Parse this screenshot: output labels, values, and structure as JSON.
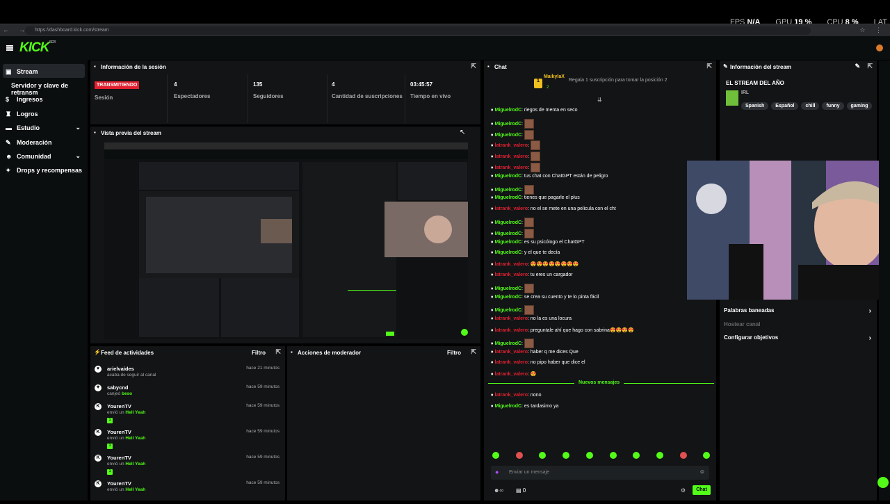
{
  "system_stats": {
    "fps_label": "FPS",
    "fps": "N/A",
    "gpu_label": "GPU",
    "gpu": "19 %",
    "cpu_label": "CPU",
    "cpu": "8 %",
    "lat_label": "LAT"
  },
  "browser": {
    "url": "https://dashboard.kick.com/stream"
  },
  "app": {
    "logo": "KICK",
    "logo_badge": "BETA"
  },
  "sidebar": {
    "items": [
      {
        "label": "Stream",
        "icon": "stream-icon"
      },
      {
        "label": "Servidor y clave de retransm"
      },
      {
        "label": "Ingresos",
        "icon": "money-icon"
      },
      {
        "label": "Logros",
        "icon": "trophy-icon"
      },
      {
        "label": "Estudio",
        "icon": "studio-icon"
      },
      {
        "label": "Moderación",
        "icon": "mod-icon"
      },
      {
        "label": "Comunidad",
        "icon": "community-icon"
      },
      {
        "label": "Drops y recompensas",
        "icon": "gift-icon"
      }
    ]
  },
  "session": {
    "title": "Información de la sesión",
    "live_badge": "TRANSMITIENDO",
    "session_label": "Sesión",
    "viewers": "4",
    "viewers_label": "Espectadores",
    "followers": "135",
    "followers_label": "Seguidores",
    "subs": "4",
    "subs_label": "Cantidad de suscripciones",
    "time": "03:45:57",
    "time_label": "Tiempo en vivo"
  },
  "preview": {
    "title": "Vista previa del stream"
  },
  "feed": {
    "title": "Feed de actividades",
    "filter": "Filtro",
    "items": [
      {
        "name": "arielvaides",
        "sub": "acaba de seguir al canal",
        "highlight": "",
        "time": "hace 21 minutos"
      },
      {
        "name": "sabycnd",
        "sub": "canjeó",
        "highlight": "beso",
        "time": "hace 59 minutos"
      },
      {
        "name": "YourenTV",
        "sub": "envió un",
        "highlight": "Hell Yeah",
        "time": "hace 59 minutos",
        "count": "1"
      },
      {
        "name": "YourenTV",
        "sub": "envió un",
        "highlight": "Hell Yeah",
        "time": "hace 59 minutos",
        "count": "1"
      },
      {
        "name": "YourenTV",
        "sub": "envió un",
        "highlight": "Hell Yeah",
        "time": "hace 59 minutos",
        "count": "1"
      },
      {
        "name": "YourenTV",
        "sub": "envió un",
        "highlight": "Hell Yeah",
        "time": "hace 59 minutos",
        "count": ""
      }
    ]
  },
  "mod": {
    "title": "Acciones de moderador",
    "filter": "Filtro"
  },
  "chat": {
    "title": "Chat",
    "top_user": "MaikylaX",
    "top_rank": "1",
    "top_count": "2",
    "gift_text": "Regala 1 suscripción para tomar la posición 2",
    "messages": [
      {
        "u": "MiguelrodC",
        "c": "g",
        "t": ": riegos de menta en seco"
      },
      {
        "u": "MiguelrodC",
        "c": "g",
        "t": ":",
        "emote": true
      },
      {
        "u": "MiguelrodC",
        "c": "g",
        "t": ":",
        "emote": true
      },
      {
        "u": "latrank_valero",
        "c": "r",
        "t": ":",
        "emote": true
      },
      {
        "u": "latrank_valero",
        "c": "r",
        "t": ":",
        "emote": true
      },
      {
        "u": "latrank_valero",
        "c": "r",
        "t": ":",
        "emote": true
      },
      {
        "u": "MiguelrodC",
        "c": "g",
        "t": ": tus chat con ChatGPT están de peligro"
      },
      {
        "u": "MiguelrodC",
        "c": "g",
        "t": ":",
        "emote": true
      },
      {
        "u": "MiguelrodC",
        "c": "g",
        "t": ": tienes que pagarle el plus"
      },
      {
        "u": "latrank_valero",
        "c": "r",
        "t": ": no el se mete en una pelicula con el cht"
      },
      {
        "u": "MiguelrodC",
        "c": "g",
        "t": ":",
        "emote": true
      },
      {
        "u": "MiguelrodC",
        "c": "g",
        "t": ":",
        "emote": true
      },
      {
        "u": "MiguelrodC",
        "c": "g",
        "t": ": es su psicólogo el ChatGPT"
      },
      {
        "u": "MiguelrodC",
        "c": "g",
        "t": ": y el que te decía"
      },
      {
        "u": "latrank_valero",
        "c": "r",
        "t": ": 😍😍😍😍😍😍😍😍"
      },
      {
        "u": "latrank_valero",
        "c": "r",
        "t": ": tu eres un cargador"
      },
      {
        "u": "MiguelrodC",
        "c": "g",
        "t": ":",
        "emote": true
      },
      {
        "u": "MiguelrodC",
        "c": "g",
        "t": ": se crea su cuento y te lo pinta fácil"
      },
      {
        "u": "MiguelrodC",
        "c": "g",
        "t": ":",
        "emote": true
      },
      {
        "u": "latrank_valero",
        "c": "r",
        "t": ": no la es una locura"
      },
      {
        "u": "latrank_valero",
        "c": "r",
        "t": ": preguntale ahí que hago con sabrina😍😍😍😍"
      },
      {
        "u": "MiguelrodC",
        "c": "g",
        "t": ":",
        "emote": true
      },
      {
        "u": "latrank_valero",
        "c": "r",
        "t": ": haber q me dices Que"
      },
      {
        "u": "latrank_valero",
        "c": "r",
        "t": ": no pipo haber que dice el"
      },
      {
        "u": "latrank_valero",
        "c": "r",
        "t": ": 😍"
      }
    ],
    "new_messages": "Nuevos mensajes",
    "after": [
      {
        "u": "latrank_valero",
        "c": "r",
        "t": ": nono"
      },
      {
        "u": "MiguelrodC",
        "c": "g",
        "t": ": es tardasimo ya"
      }
    ],
    "input_placeholder": "Enviar un mensaje",
    "viewers_count": "0",
    "send": "Chat"
  },
  "stream_info": {
    "title": "Información del stream",
    "stream_title": "EL STREAM DEL AÑO",
    "category": "IRL",
    "tags": [
      "Spanish",
      "Español",
      "chill",
      "funny",
      "gaming"
    ],
    "banned_words": "Palabras baneadas",
    "host": "Hostear canal",
    "goals": "Configurar objetivos"
  },
  "colors": {
    "accent": "#53fc18",
    "live": "#e0202f",
    "panel": "#121416",
    "bg": "#000000"
  }
}
